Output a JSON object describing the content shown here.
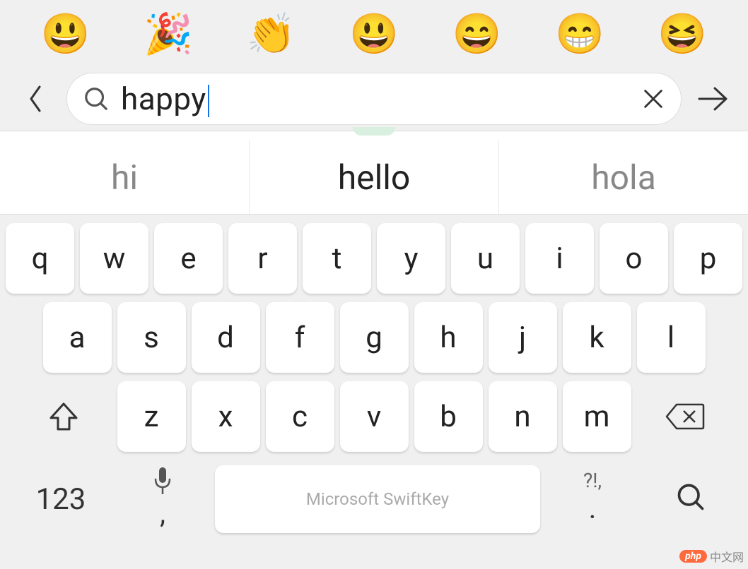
{
  "emoji_suggestions": [
    "😃",
    "🎉",
    "👏",
    "😃",
    "😄",
    "😁",
    "😆"
  ],
  "search": {
    "value": "happy",
    "placeholder": ""
  },
  "word_suggestions": {
    "left": "hi",
    "center": "hello",
    "right": "hola"
  },
  "keyboard": {
    "row1": [
      "q",
      "w",
      "e",
      "r",
      "t",
      "y",
      "u",
      "i",
      "o",
      "p"
    ],
    "row2": [
      "a",
      "s",
      "d",
      "f",
      "g",
      "h",
      "j",
      "k",
      "l"
    ],
    "row3": [
      "z",
      "x",
      "c",
      "v",
      "b",
      "n",
      "m"
    ],
    "mode_toggle": "123",
    "mic_sublabel": ",",
    "punct_top": "?!,",
    "punct_sublabel": ".",
    "spacebar_label": "Microsoft SwiftKey"
  },
  "watermark": {
    "pill": "php",
    "text": "中文网"
  }
}
